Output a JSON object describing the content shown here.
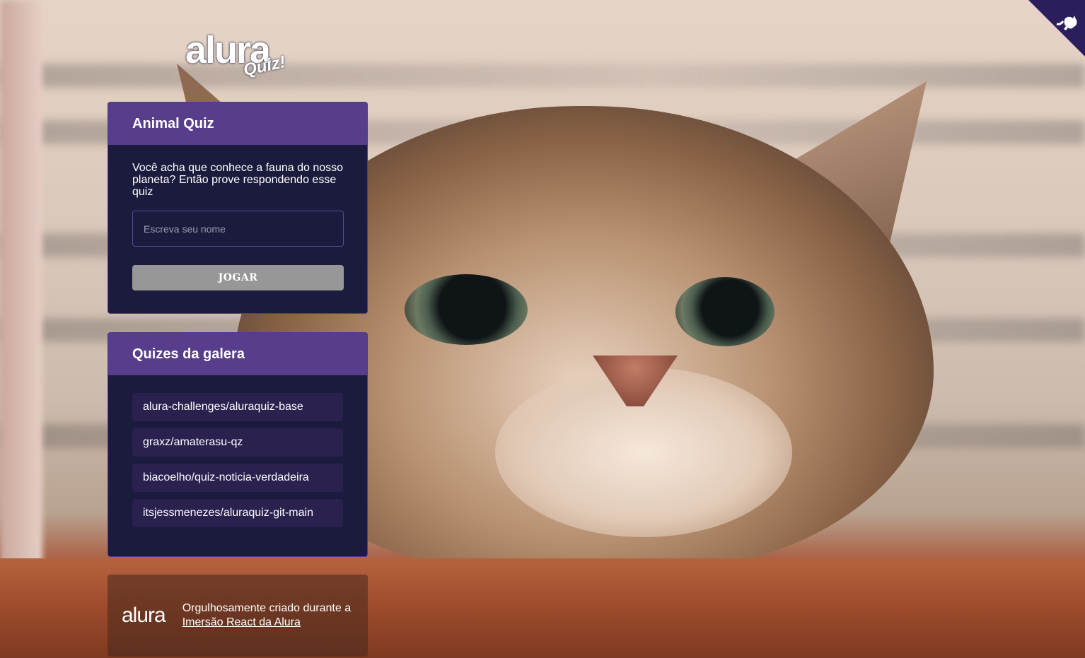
{
  "logo": {
    "wordmark": "alura",
    "subtitle": "Quiz!"
  },
  "quiz_widget": {
    "title": "Animal Quiz",
    "description": "Você acha que conhece a fauna do nosso planeta? Então prove respondendo esse quiz",
    "name_input": {
      "placeholder": "Escreva seu nome",
      "value": ""
    },
    "play_button": "JOGAR"
  },
  "galera_widget": {
    "title": "Quizes da galera",
    "links": [
      "alura-challenges/aluraquiz-base",
      "graxz/amaterasu-qz",
      "biacoelho/quiz-noticia-verdadeira",
      "itsjessmenezes/aluraquiz-git-main"
    ]
  },
  "footer": {
    "logo": "alura",
    "text_prefix": "Orgulhosamente criado durante a ",
    "link_text": "Imersão React da Alura"
  },
  "corner": {
    "icon": "github-octocat-icon",
    "color": "#2a1f5c"
  },
  "colors": {
    "primary": "#573d8c",
    "widget_bg": "#1b1b3d",
    "button_disabled": "#979797"
  }
}
